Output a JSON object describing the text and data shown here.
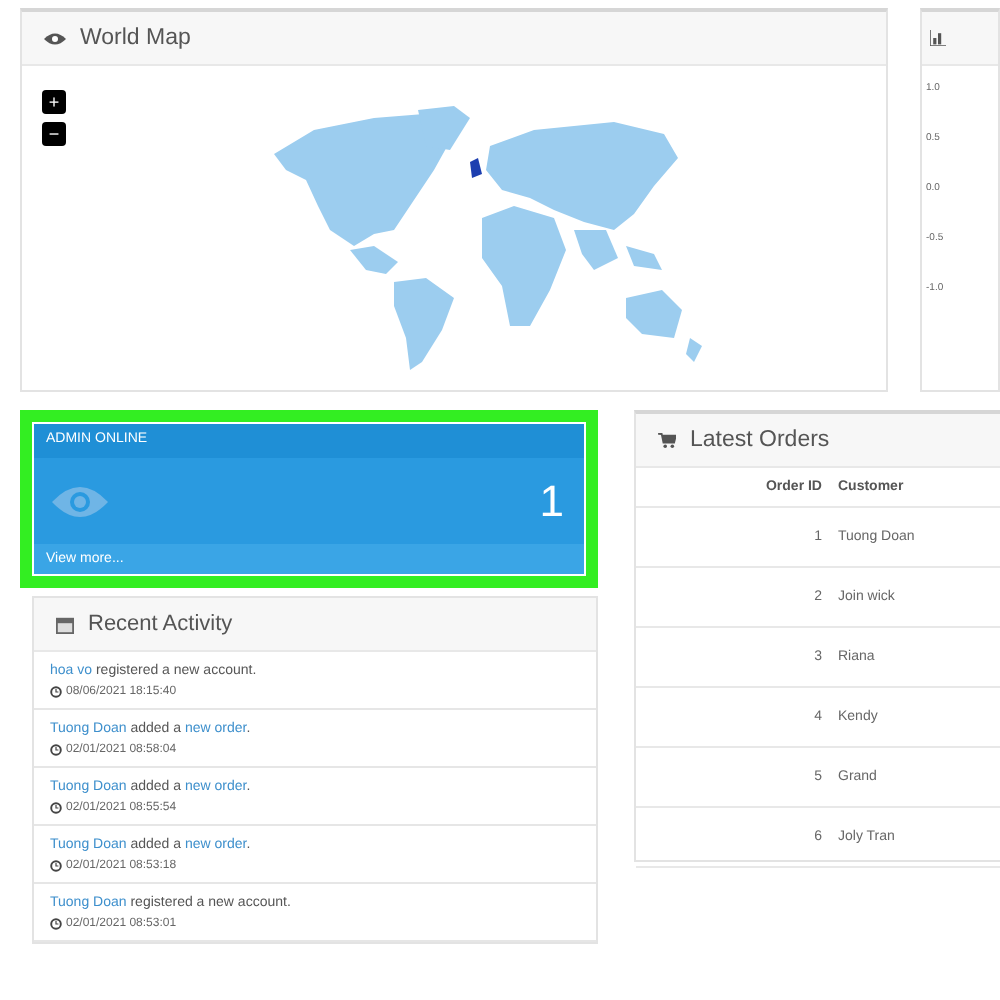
{
  "world_map": {
    "title": "World Map",
    "zoom_controls": [
      "+",
      "−"
    ]
  },
  "chart_panel": {
    "yticks": [
      "1.0",
      "0.5",
      "0.0",
      "-0.5",
      "-1.0"
    ]
  },
  "admin_card": {
    "title": "ADMIN ONLINE",
    "count": "1",
    "link": "View more...",
    "highlighted": true
  },
  "recent_activity": {
    "title": "Recent Activity",
    "items": [
      {
        "parts": [
          {
            "text": "hoa vo",
            "link": true
          },
          {
            "text": " registered a new account.",
            "link": false
          }
        ],
        "time": "08/06/2021 18:15:40"
      },
      {
        "parts": [
          {
            "text": "Tuong Doan",
            "link": true
          },
          {
            "text": " added a ",
            "link": false
          },
          {
            "text": "new order",
            "link": true
          },
          {
            "text": ".",
            "link": false
          }
        ],
        "time": "02/01/2021 08:58:04"
      },
      {
        "parts": [
          {
            "text": "Tuong Doan",
            "link": true
          },
          {
            "text": " added a ",
            "link": false
          },
          {
            "text": "new order",
            "link": true
          },
          {
            "text": ".",
            "link": false
          }
        ],
        "time": "02/01/2021 08:55:54"
      },
      {
        "parts": [
          {
            "text": "Tuong Doan",
            "link": true
          },
          {
            "text": " added a ",
            "link": false
          },
          {
            "text": "new order",
            "link": true
          },
          {
            "text": ".",
            "link": false
          }
        ],
        "time": "02/01/2021 08:53:18"
      },
      {
        "parts": [
          {
            "text": "Tuong Doan",
            "link": true
          },
          {
            "text": " registered a new account.",
            "link": false
          }
        ],
        "time": "02/01/2021 08:53:01"
      }
    ]
  },
  "latest_orders": {
    "title": "Latest Orders",
    "columns": [
      "Order ID",
      "Customer"
    ],
    "rows": [
      [
        "1",
        "Tuong Doan"
      ],
      [
        "2",
        "Join wick"
      ],
      [
        "3",
        "Riana"
      ],
      [
        "4",
        "Kendy"
      ],
      [
        "5",
        "Grand"
      ],
      [
        "6",
        "Joly Tran"
      ]
    ]
  }
}
